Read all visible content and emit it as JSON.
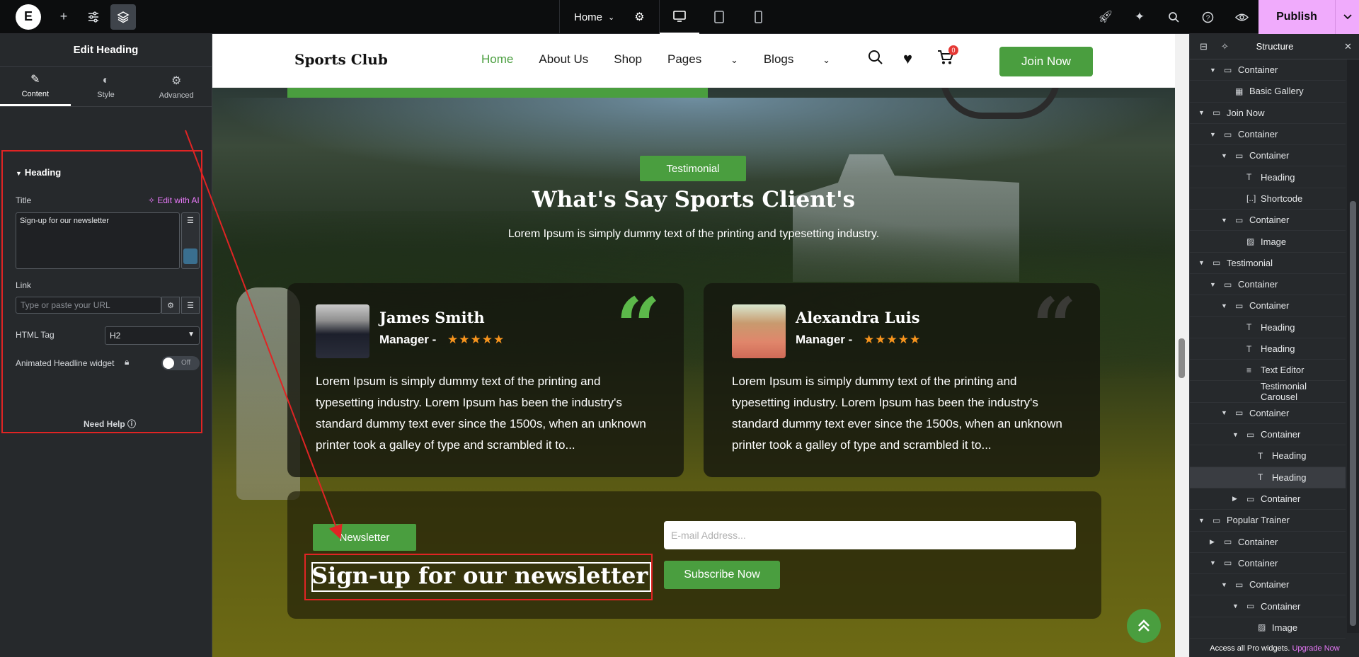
{
  "topbar": {
    "logo": "E",
    "page_name": "Home",
    "publish_label": "Publish"
  },
  "left_panel": {
    "title": "Edit Heading",
    "tabs": [
      {
        "label": "Content",
        "active": true
      },
      {
        "label": "Style",
        "active": false
      },
      {
        "label": "Advanced",
        "active": false
      }
    ],
    "section_title": "Heading",
    "title_label": "Title",
    "edit_ai_label": "Edit with AI",
    "title_value": "Sign-up for our newsletter",
    "link_label": "Link",
    "link_placeholder": "Type or paste your URL",
    "html_tag_label": "HTML Tag",
    "html_tag_value": "H2",
    "animated_label": "Animated Headline widget",
    "toggle_value": "Off",
    "need_help": "Need Help"
  },
  "site": {
    "brand": "Sports Club",
    "nav": [
      "Home",
      "About Us",
      "Shop",
      "Pages",
      "Blogs"
    ],
    "cart_count": "0",
    "join_label": "Join Now",
    "testimonial_pill": "Testimonial",
    "heading": "What's Say Sports Client's",
    "subheading": "Lorem Ipsum is simply dummy text of the printing and typesetting industry.",
    "cards": [
      {
        "name": "James Smith",
        "role": "Manager -",
        "stars": "★★★★★",
        "text": "Lorem Ipsum is simply dummy text of the printing and typesetting industry. Lorem Ipsum has been the industry's standard dummy text ever since the 1500s, when an unknown printer took a galley of type and scrambled it to..."
      },
      {
        "name": "Alexandra Luis",
        "role": "Manager -",
        "stars": "★★★★★",
        "text": "Lorem Ipsum is simply dummy text of the printing and typesetting industry. Lorem Ipsum has been the industry's standard dummy text ever since the 1500s, when an unknown printer took a galley of type and scrambled it to..."
      }
    ],
    "newsletter_pill": "Newsletter",
    "newsletter_title": "Sign-up for our newsletter",
    "email_placeholder": "E-mail Address...",
    "subscribe_label": "Subscribe Now"
  },
  "structure": {
    "title": "Structure",
    "items": [
      {
        "label": "Container",
        "depth": 1,
        "arrow": "down"
      },
      {
        "label": "Basic Gallery",
        "depth": 2,
        "arrow": ""
      },
      {
        "label": "Join Now",
        "depth": 0,
        "arrow": "down"
      },
      {
        "label": "Container",
        "depth": 1,
        "arrow": "down"
      },
      {
        "label": "Container",
        "depth": 2,
        "arrow": "down"
      },
      {
        "label": "Heading",
        "depth": 3,
        "arrow": ""
      },
      {
        "label": "Shortcode",
        "depth": 3,
        "arrow": ""
      },
      {
        "label": "Container",
        "depth": 2,
        "arrow": "down"
      },
      {
        "label": "Image",
        "depth": 3,
        "arrow": ""
      },
      {
        "label": "Testimonial",
        "depth": 0,
        "arrow": "down"
      },
      {
        "label": "Container",
        "depth": 1,
        "arrow": "down"
      },
      {
        "label": "Container",
        "depth": 2,
        "arrow": "down"
      },
      {
        "label": "Heading",
        "depth": 3,
        "arrow": ""
      },
      {
        "label": "Heading",
        "depth": 3,
        "arrow": ""
      },
      {
        "label": "Text Editor",
        "depth": 3,
        "arrow": ""
      },
      {
        "label": "Testimonial Carousel",
        "depth": 3,
        "arrow": ""
      },
      {
        "label": "Container",
        "depth": 2,
        "arrow": "down"
      },
      {
        "label": "Container",
        "depth": 3,
        "arrow": "down"
      },
      {
        "label": "Heading",
        "depth": 4,
        "arrow": ""
      },
      {
        "label": "Heading",
        "depth": 4,
        "arrow": "",
        "selected": true
      },
      {
        "label": "Container",
        "depth": 3,
        "arrow": "right"
      },
      {
        "label": "Popular Trainer",
        "depth": 0,
        "arrow": "down"
      },
      {
        "label": "Container",
        "depth": 1,
        "arrow": "right"
      },
      {
        "label": "Container",
        "depth": 1,
        "arrow": "down"
      },
      {
        "label": "Container",
        "depth": 2,
        "arrow": "down"
      },
      {
        "label": "Container",
        "depth": 3,
        "arrow": "down"
      },
      {
        "label": "Image",
        "depth": 4,
        "arrow": ""
      }
    ],
    "footer_text": "Access all Pro widgets.",
    "footer_link": "Upgrade Now"
  },
  "colors": {
    "accent_green": "#4a9e3f",
    "publish_pink": "#f0abfc",
    "highlight_red": "#e02424"
  }
}
